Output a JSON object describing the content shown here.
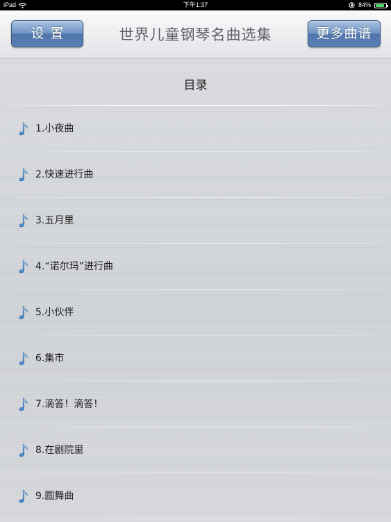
{
  "status_bar": {
    "device": "iPad",
    "time": "下午1:37",
    "battery": "84%",
    "battery_level": 0.84,
    "wifi_icon": "wifi-icon",
    "rotation_lock_icon": "lock-rotation-icon"
  },
  "nav": {
    "title": "世界儿童钢琴名曲选集",
    "settings_label": "设置",
    "more_label": "更多曲谱",
    "button_color": "#5a80b5"
  },
  "content": {
    "section_title": "目录",
    "item_icon": "music-note-icon",
    "songs": [
      {
        "label": "1.小夜曲"
      },
      {
        "label": "2.快速进行曲"
      },
      {
        "label": "3.五月里"
      },
      {
        "label": "4.“诺尔玛”进行曲"
      },
      {
        "label": "5.小伙伴"
      },
      {
        "label": "6.集市"
      },
      {
        "label": "7.滴答！滴答！"
      },
      {
        "label": "8.在剧院里"
      },
      {
        "label": "9.圆舞曲"
      }
    ]
  }
}
